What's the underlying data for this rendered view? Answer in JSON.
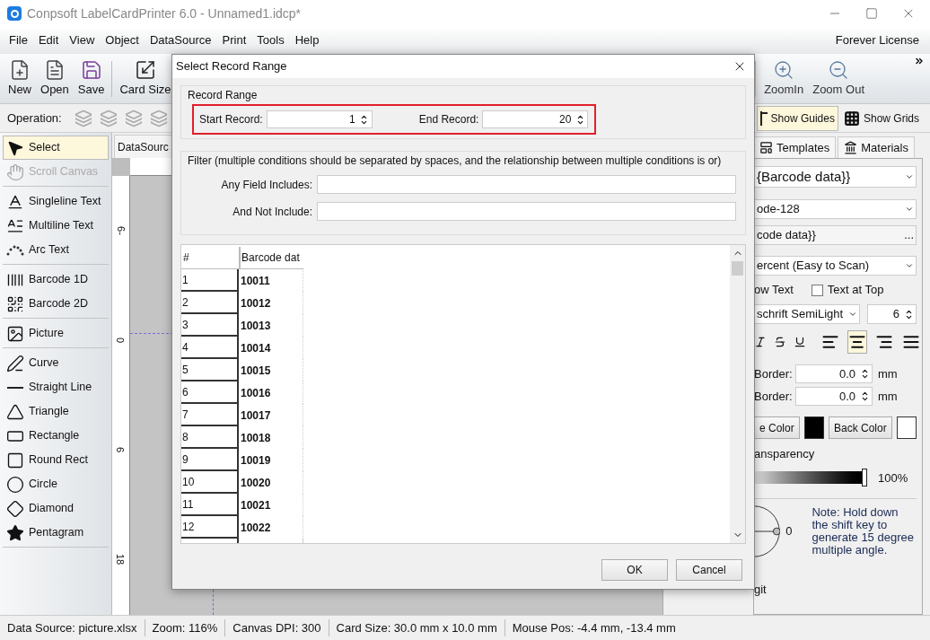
{
  "window": {
    "title": "Conpsoft LabelCardPrinter 6.0 - Unnamed1.idcp*"
  },
  "menu": [
    "File",
    "Edit",
    "View",
    "Object",
    "DataSource",
    "Print",
    "Tools",
    "Help"
  ],
  "license": "Forever License",
  "toolbar": [
    {
      "label": "New"
    },
    {
      "label": "Open"
    },
    {
      "label": "Save"
    },
    {
      "label": "Card Size"
    }
  ],
  "toolbar_right": [
    {
      "label": "ZoomIn"
    },
    {
      "label": "Zoom Out"
    }
  ],
  "operation_label": "Operation:",
  "view_toggles": [
    {
      "label": "Show Guides",
      "selected": true
    },
    {
      "label": "Show Grids",
      "selected": false
    }
  ],
  "tool_groups": [
    [
      {
        "label": "Select",
        "selected": true,
        "disabled": false
      },
      {
        "label": "Scroll Canvas",
        "selected": false,
        "disabled": true
      }
    ],
    [
      {
        "label": "Singleline Text",
        "selected": false,
        "disabled": false
      },
      {
        "label": "Multiline Text",
        "selected": false,
        "disabled": false
      },
      {
        "label": "Arc Text",
        "selected": false,
        "disabled": false
      }
    ],
    [
      {
        "label": "Barcode 1D",
        "selected": false,
        "disabled": false
      },
      {
        "label": "Barcode 2D",
        "selected": false,
        "disabled": false
      }
    ],
    [
      {
        "label": "Picture",
        "selected": false,
        "disabled": false
      }
    ],
    [
      {
        "label": "Curve",
        "selected": false,
        "disabled": false
      },
      {
        "label": "Straight Line",
        "selected": false,
        "disabled": false
      },
      {
        "label": "Triangle",
        "selected": false,
        "disabled": false
      },
      {
        "label": "Rectangle",
        "selected": false,
        "disabled": false
      },
      {
        "label": "Round Rect",
        "selected": false,
        "disabled": false
      },
      {
        "label": "Circle",
        "selected": false,
        "disabled": false
      },
      {
        "label": "Diamond",
        "selected": false,
        "disabled": false
      },
      {
        "label": "Pentagram",
        "selected": false,
        "disabled": false
      }
    ]
  ],
  "canvas": {
    "tab": "DataSourc",
    "ruler_labels": [
      "6-",
      "0",
      "6",
      "18"
    ]
  },
  "right_panel": {
    "tabs": [
      "Templates",
      "Materials"
    ],
    "data_field": "{Barcode data}}",
    "barcode_type": "ode-128",
    "barcode_content": "code data}}",
    "more": "...",
    "quality": "ercent (Easy to Scan)",
    "show_text": "ow Text",
    "text_at_top": {
      "label": "Text at Top",
      "checked": false
    },
    "font": "schrift SemiLight",
    "font_size": "6",
    "alignment": [
      {
        "selected": false
      },
      {
        "selected": true
      },
      {
        "selected": false
      },
      {
        "selected": false
      }
    ],
    "borders": [
      {
        "label": "Border:",
        "value": "0.0",
        "unit": "mm"
      },
      {
        "label": "Border:",
        "value": "0.0",
        "unit": "mm"
      }
    ],
    "colors": [
      {
        "label": "e Color",
        "color": "#000000"
      },
      {
        "label": "Back Color",
        "color": "#ffffff"
      }
    ],
    "transparency": {
      "label": "ansparency",
      "level": 1,
      "reading": "100%"
    },
    "angle": "0",
    "note": "Note: Hold down the shift key to generate 15 degree multiple angle.",
    "bottom_text": "git"
  },
  "dialog": {
    "title": "Select Record Range",
    "range_group": "Record Range",
    "start_label": "Start Record:",
    "start_value": "1",
    "end_label": "End Record:",
    "end_value": "20",
    "filter_group": "Filter (multiple conditions should be separated by spaces, and the relationship between multiple conditions is or)",
    "filter_fields": [
      {
        "label": "Any Field Includes:"
      },
      {
        "label": "And Not Include:"
      }
    ],
    "table": {
      "columns": [
        "#",
        "Barcode dat"
      ],
      "rows": [
        [
          "1",
          "10011"
        ],
        [
          "2",
          "10012"
        ],
        [
          "3",
          "10013"
        ],
        [
          "4",
          "10014"
        ],
        [
          "5",
          "10015"
        ],
        [
          "6",
          "10016"
        ],
        [
          "7",
          "10017"
        ],
        [
          "8",
          "10018"
        ],
        [
          "9",
          "10019"
        ],
        [
          "10",
          "10020"
        ],
        [
          "11",
          "10021"
        ],
        [
          "12",
          "10022"
        ]
      ]
    },
    "buttons": [
      "OK",
      "Cancel"
    ]
  },
  "status_bar": [
    "Data Source: picture.xlsx",
    "Zoom: 116%",
    "Canvas DPI: 300",
    "Card Size: 30.0 mm x 10.0 mm",
    "Mouse Pos: -4.4 mm, -13.4 mm"
  ]
}
